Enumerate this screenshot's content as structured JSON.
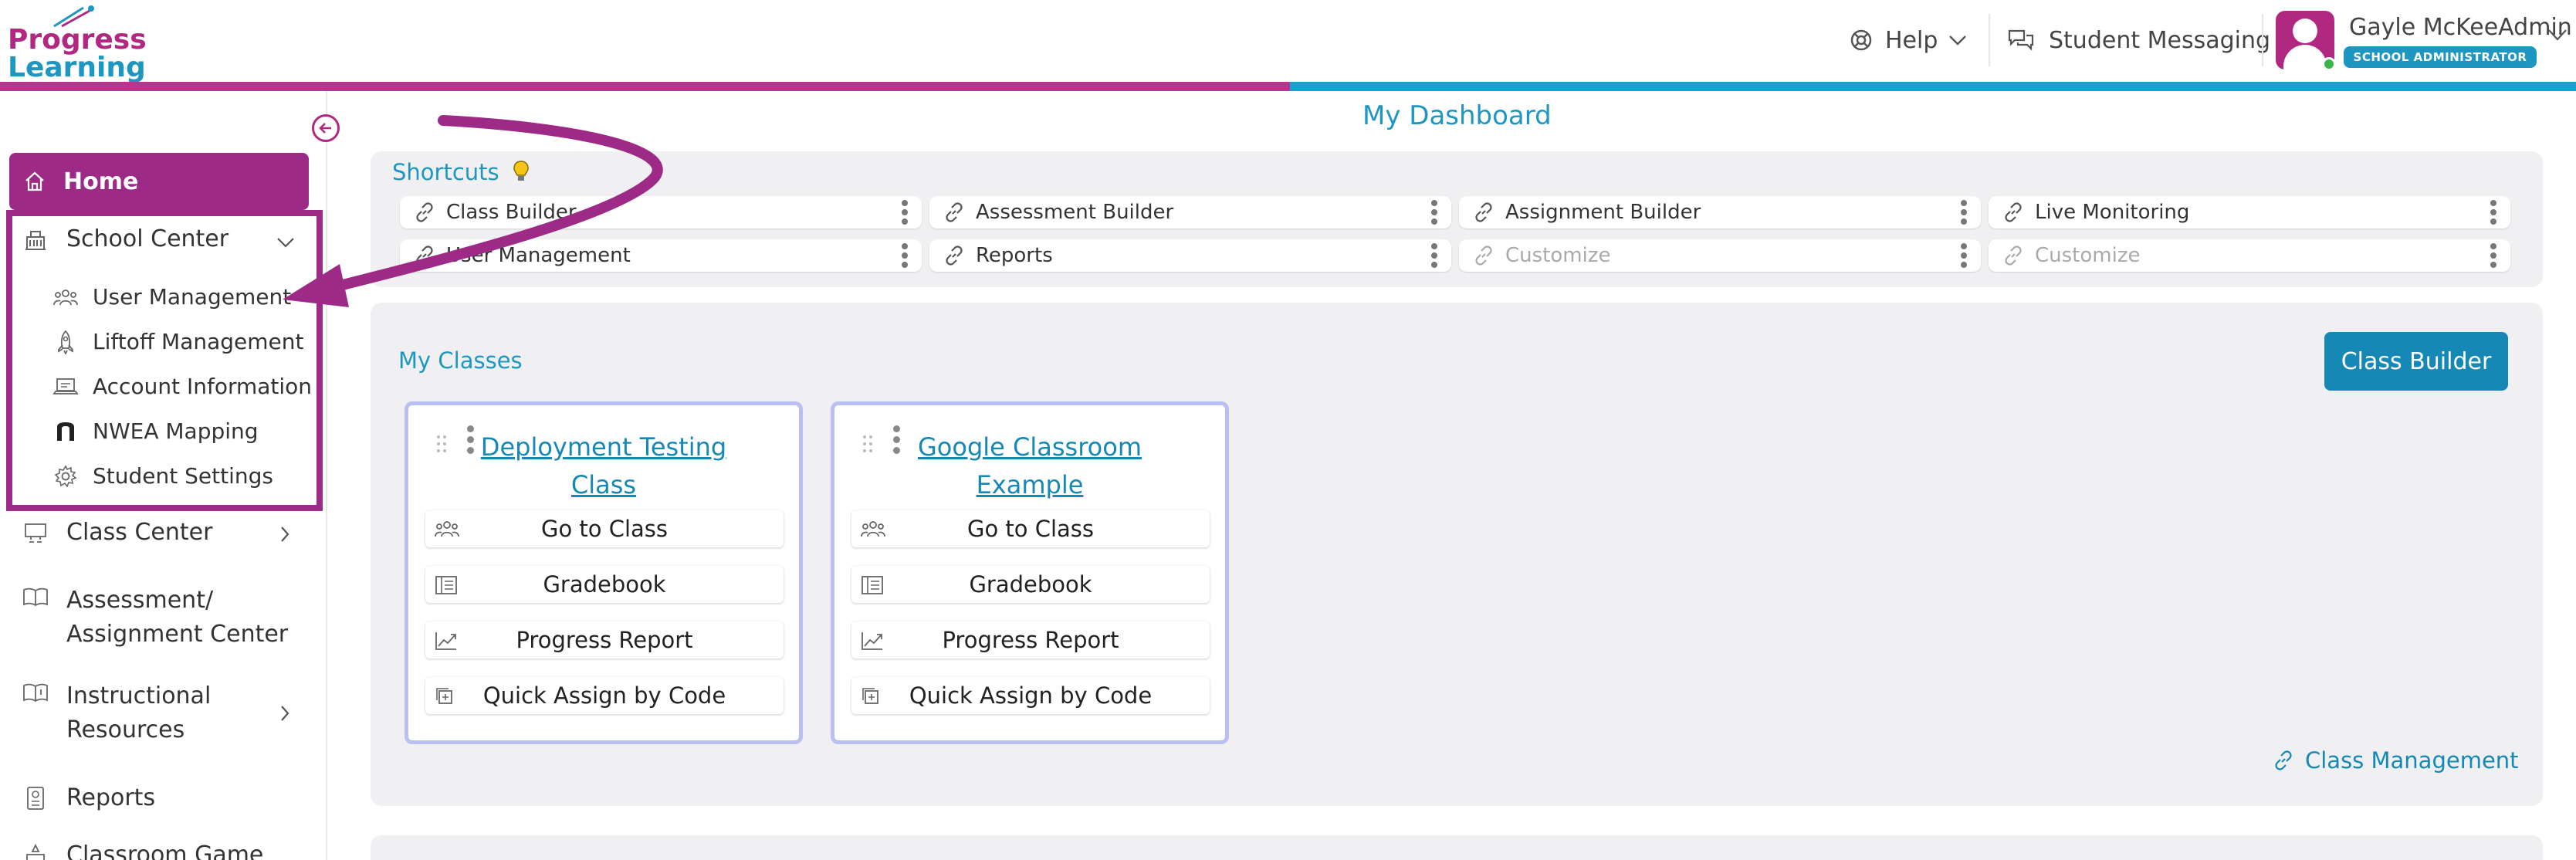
{
  "header": {
    "logo_line1": "Progress",
    "logo_line2": "Learning",
    "help_label": "Help",
    "messaging_label": "Student Messaging",
    "user_name": "Gayle McKeeAdmin",
    "user_role": "SCHOOL ADMINISTRATOR",
    "icons": [
      "lifebuoy-icon",
      "chevron-down-icon",
      "chat-bubbles-icon",
      "avatar",
      "chevron-down-icon"
    ]
  },
  "colors": {
    "brand_magenta": "#9c2a86",
    "brand_blue": "#1d97c2",
    "panel_bg": "#f0f0f2"
  },
  "sidebar": {
    "home": "Home",
    "school_center": {
      "label": "School Center",
      "items": [
        {
          "label": "User Management",
          "icon": "users-icon"
        },
        {
          "label": "Liftoff Management",
          "icon": "rocket-icon"
        },
        {
          "label": "Account Information",
          "icon": "laptop-icon"
        },
        {
          "label": "NWEA Mapping",
          "icon": "nwea-icon"
        },
        {
          "label": "Student Settings",
          "icon": "gear-icon"
        }
      ]
    },
    "class_center": "Class Center",
    "assessment_center_line1": "Assessment/",
    "assessment_center_line2": "Assignment Center",
    "instructional_line1": "Instructional",
    "instructional_line2": "Resources",
    "reports": "Reports",
    "classroom_game": "Classroom Game"
  },
  "main": {
    "title": "My Dashboard",
    "shortcuts_title": "Shortcuts",
    "shortcuts": [
      "Class Builder",
      "Assessment Builder",
      "Assignment Builder",
      "Live Monitoring",
      "User Management",
      "Reports",
      "Customize",
      "Customize"
    ],
    "my_classes_title": "My Classes",
    "class_builder_button": "Class Builder",
    "class_management_link": "Class Management",
    "classes": [
      {
        "title_line1": "Deployment Testing",
        "title_line2": "Class",
        "actions": [
          "Go to Class",
          "Gradebook",
          "Progress Report",
          "Quick Assign by Code"
        ]
      },
      {
        "title_line1": "Google Classroom",
        "title_line2": "Example",
        "actions": [
          "Go to Class",
          "Gradebook",
          "Progress Report",
          "Quick Assign by Code"
        ]
      }
    ]
  }
}
